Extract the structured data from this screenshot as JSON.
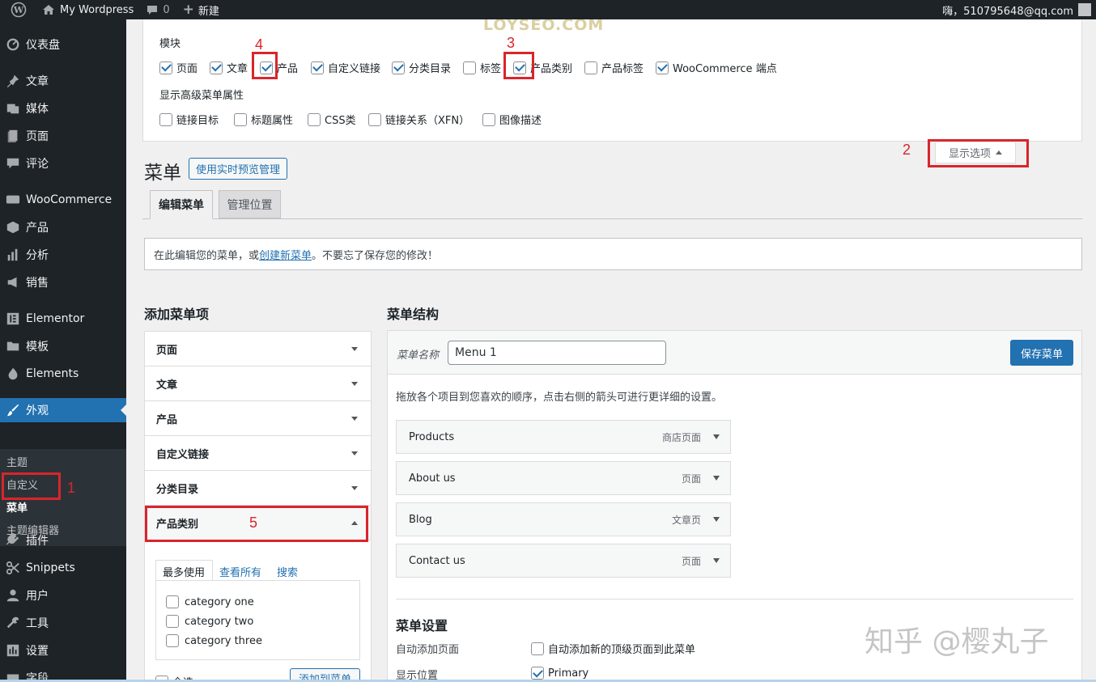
{
  "admin_bar": {
    "site_name": "My Wordpress",
    "comments_count": "0",
    "new_label": "新建",
    "greeting": "嗨，510795648@qq.com"
  },
  "sidebar": {
    "items": [
      {
        "label": "仪表盘",
        "icon": "dashboard-icon"
      },
      {
        "label": "文章",
        "icon": "pin-icon"
      },
      {
        "label": "媒体",
        "icon": "media-icon"
      },
      {
        "label": "页面",
        "icon": "page-icon"
      },
      {
        "label": "评论",
        "icon": "comment-icon"
      },
      {
        "label": "WooCommerce",
        "icon": "woocommerce-icon"
      },
      {
        "label": "产品",
        "icon": "box-icon"
      },
      {
        "label": "分析",
        "icon": "bar-chart-icon"
      },
      {
        "label": "销售",
        "icon": "megaphone-icon"
      },
      {
        "label": "Elementor",
        "icon": "elementor-icon"
      },
      {
        "label": "模板",
        "icon": "folder-icon"
      },
      {
        "label": "Elements",
        "icon": "flame-icon"
      },
      {
        "label": "外观",
        "icon": "brush-icon"
      },
      {
        "label": "插件",
        "icon": "plug-icon"
      },
      {
        "label": "Snippets",
        "icon": "scissors-icon"
      },
      {
        "label": "用户",
        "icon": "user-icon"
      },
      {
        "label": "工具",
        "icon": "wrench-icon"
      },
      {
        "label": "设置",
        "icon": "settings-icon"
      },
      {
        "label": "字段",
        "icon": "field-icon"
      }
    ],
    "submenu": [
      "主题",
      "自定义",
      "菜单",
      "主题编辑器"
    ]
  },
  "screen_options": {
    "modules_label": "模块",
    "modules": [
      {
        "label": "页面",
        "checked": true
      },
      {
        "label": "文章",
        "checked": true
      },
      {
        "label": "产品",
        "checked": true
      },
      {
        "label": "自定义链接",
        "checked": true
      },
      {
        "label": "分类目录",
        "checked": true
      },
      {
        "label": "标签",
        "checked": false
      },
      {
        "label": "产品类别",
        "checked": true
      },
      {
        "label": "产品标签",
        "checked": false
      },
      {
        "label": "WooCommerce 端点",
        "checked": true
      }
    ],
    "advanced_label": "显示高级菜单属性",
    "advanced": [
      {
        "label": "链接目标",
        "checked": false
      },
      {
        "label": "标题属性",
        "checked": false
      },
      {
        "label": "CSS类",
        "checked": false
      },
      {
        "label": "链接关系（XFN）",
        "checked": false
      },
      {
        "label": "图像描述",
        "checked": false
      }
    ],
    "toggle_label": "显示选项"
  },
  "watermark_top": "LOYSEO.COM",
  "annotations": [
    "1",
    "2",
    "3",
    "4",
    "5"
  ],
  "page": {
    "title": "菜单",
    "live_preview_label": "使用实时预览管理",
    "tabs": [
      "编辑菜单",
      "管理位置"
    ],
    "notice_before": "在此编辑您的菜单，或",
    "notice_link": "创建新菜单",
    "notice_after": "。不要忘了保存您的修改！"
  },
  "add_items": {
    "heading": "添加菜单项",
    "sections": [
      "页面",
      "文章",
      "产品",
      "自定义链接",
      "分类目录",
      "产品类别"
    ],
    "tabs": [
      "最多使用",
      "查看所有",
      "搜索"
    ],
    "categories": [
      "category one",
      "category two",
      "category three"
    ],
    "select_all_label": "全选",
    "add_button": "添加到菜单"
  },
  "structure": {
    "heading": "菜单结构",
    "menu_name_label": "菜单名称",
    "menu_name_value": "Menu 1",
    "save_label": "保存菜单",
    "hint": "拖放各个项目到您喜欢的顺序，点击右侧的箭头可进行更详细的设置。",
    "items": [
      {
        "title": "Products",
        "type": "商店页面"
      },
      {
        "title": "About us",
        "type": "页面"
      },
      {
        "title": "Blog",
        "type": "文章页"
      },
      {
        "title": "Contact us",
        "type": "页面"
      }
    ],
    "settings_heading": "菜单设置",
    "auto_add_label": "自动添加页面",
    "auto_add_option": "自动添加新的顶级页面到此菜单",
    "location_label": "显示位置",
    "location_option": "Primary"
  },
  "watermark_zhihu": "知乎 @樱丸子"
}
